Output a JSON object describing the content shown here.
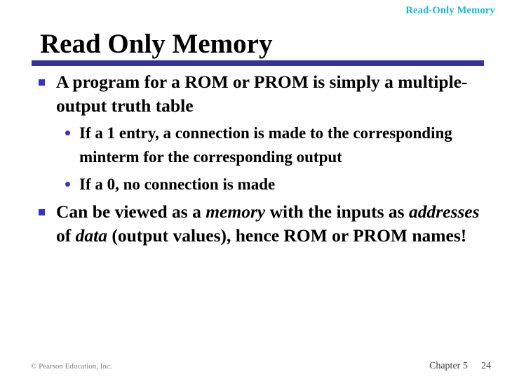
{
  "header": {
    "running_title": "Read-Only Memory",
    "running_title_color": "#12b8dd"
  },
  "title": {
    "text": "Read Only Memory",
    "rule_color": "#333399"
  },
  "content": {
    "bullet_square_color": "#3333cc",
    "bullet_dot_color": "#3333cc",
    "items": [
      {
        "level": 1,
        "marker": "square-bullet",
        "text": "A program for a ROM or PROM is simply a multiple-output truth table"
      },
      {
        "level": 2,
        "marker": "round-bullet",
        "text": "If a 1 entry, a connection is made to the corresponding minterm for the corresponding output"
      },
      {
        "level": 2,
        "marker": "round-bullet",
        "text": "If a 0, no connection is made"
      },
      {
        "level": 1,
        "marker": "square-bullet",
        "text_parts": {
          "p1": "Can be viewed as a ",
          "i1": "memory",
          "p2": " with the inputs as ",
          "i2": "addresses",
          "p3": " of ",
          "i3": "data",
          "p4": " (output values), hence ROM or PROM names!"
        }
      }
    ]
  },
  "footer": {
    "copyright": "© Pearson Education, Inc.",
    "chapter": "Chapter 5",
    "page_number": "24"
  }
}
